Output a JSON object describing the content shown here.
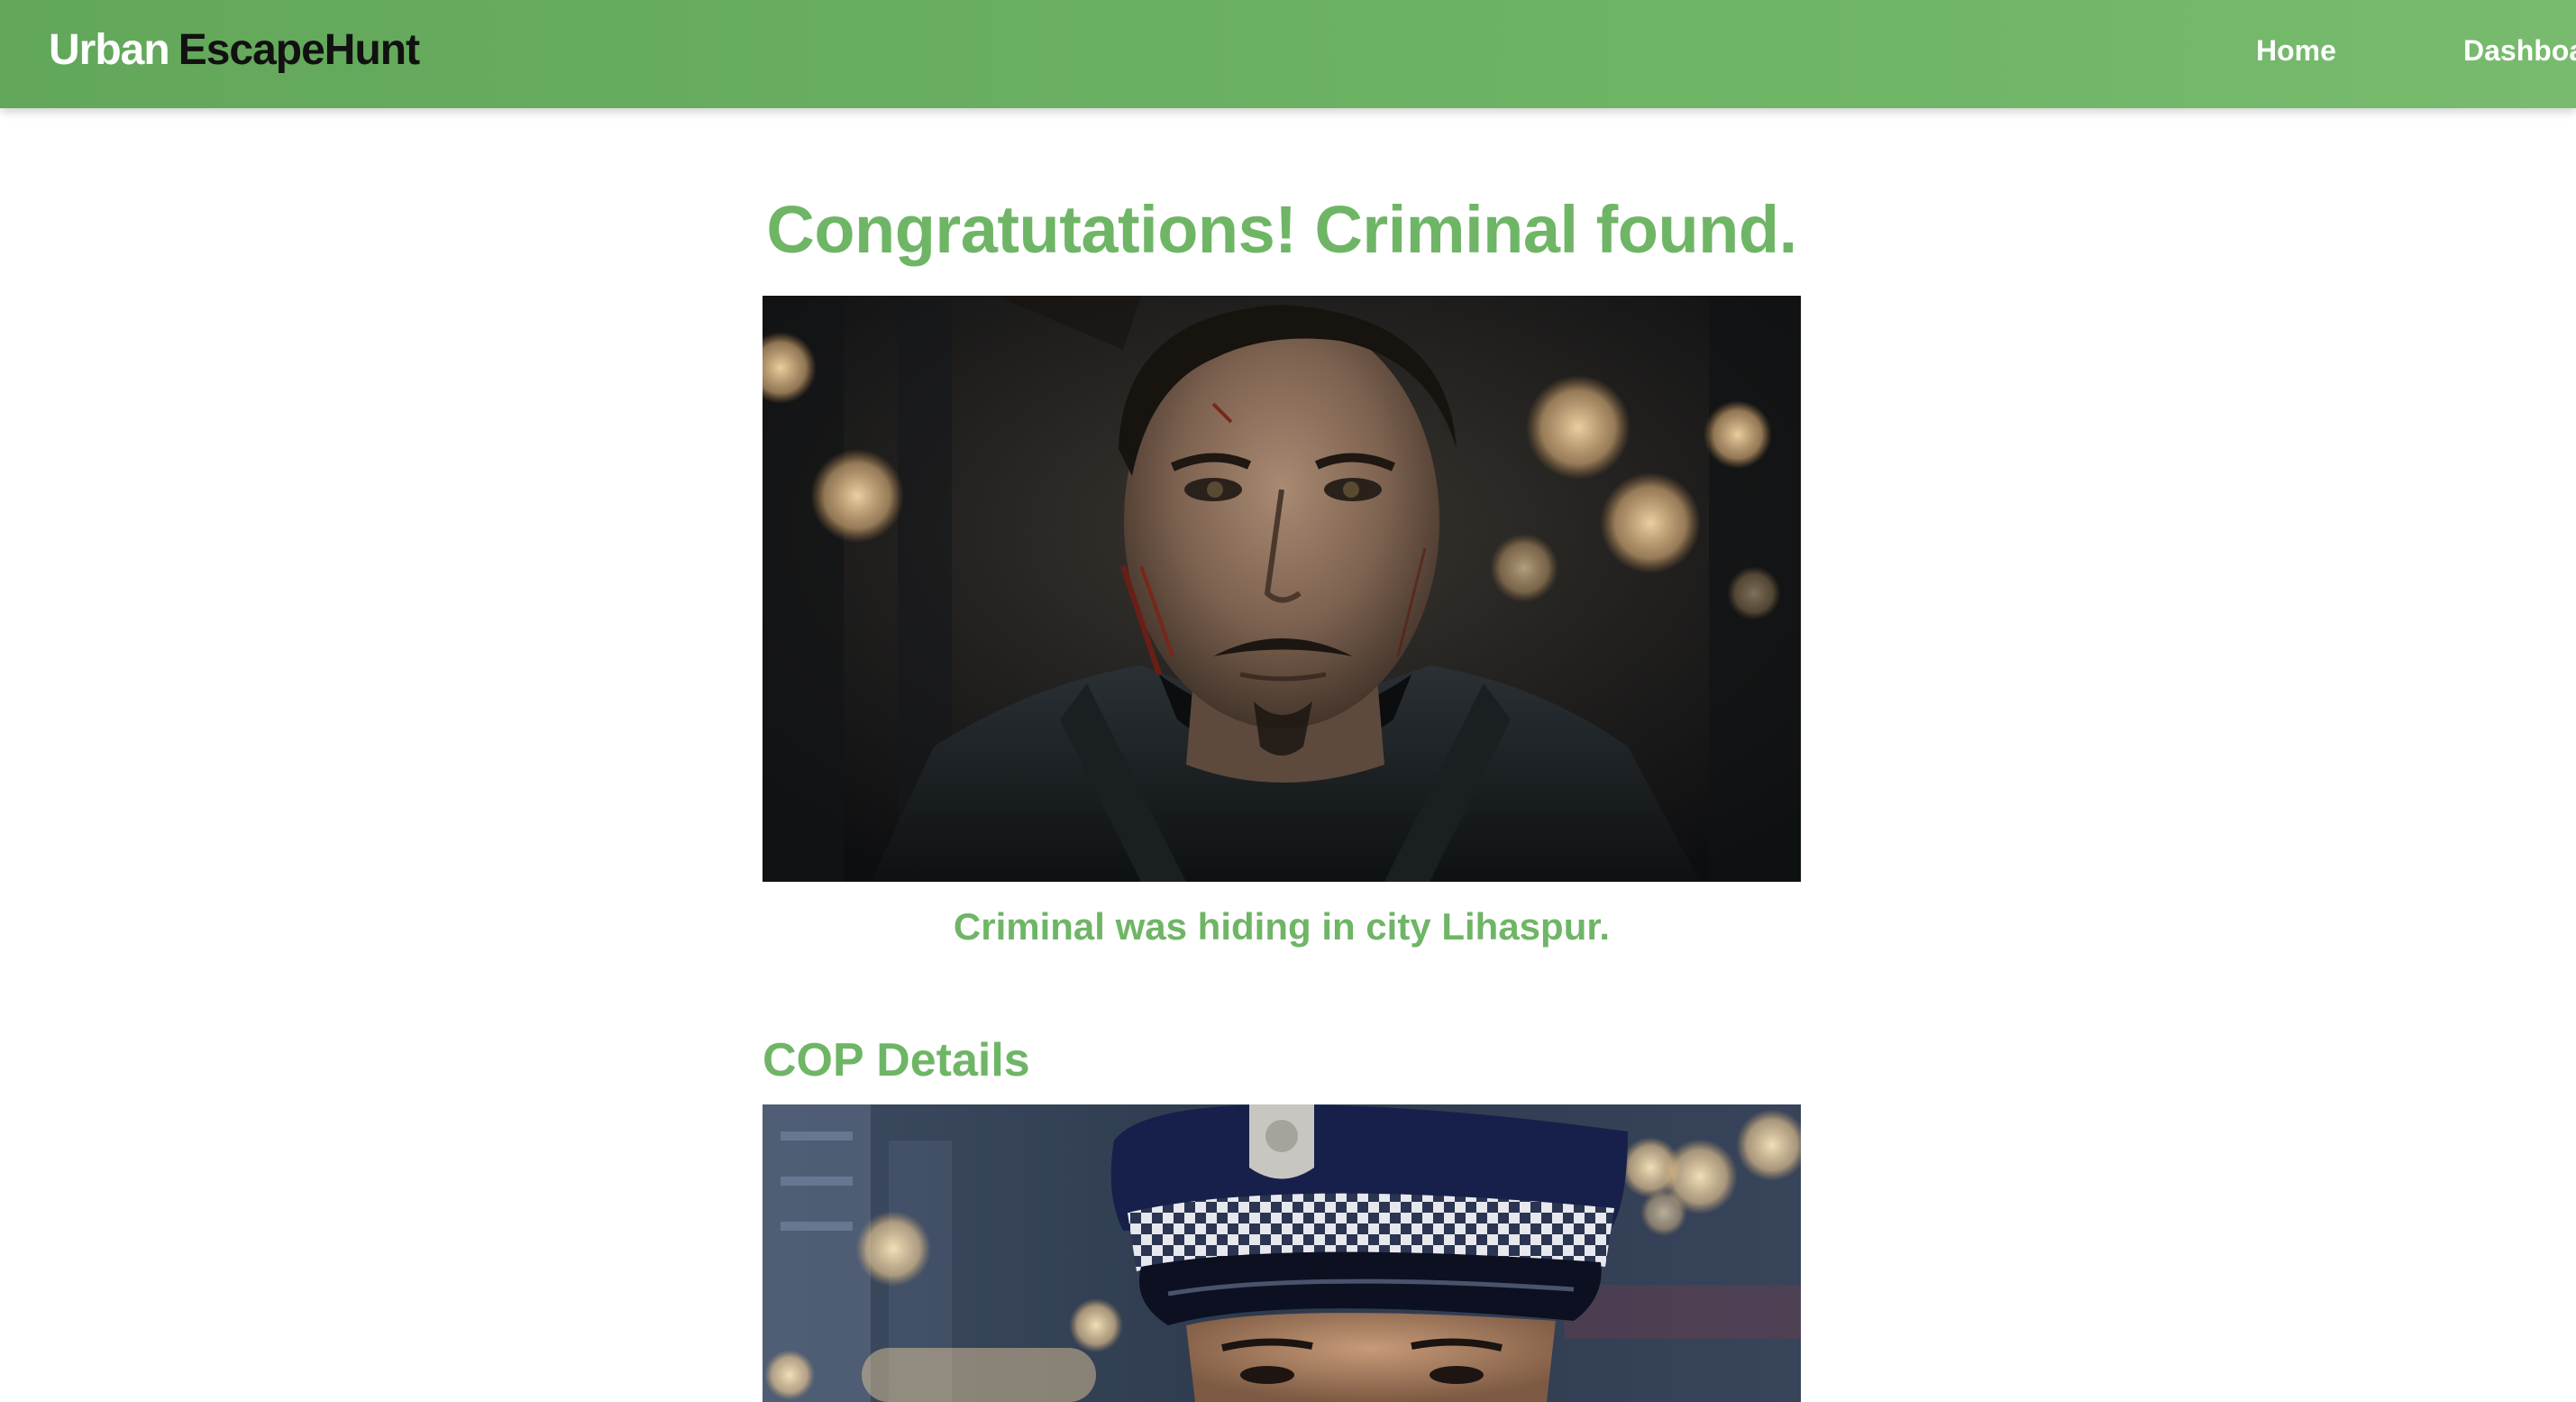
{
  "navbar": {
    "brand_part1": "Urban",
    "brand_part2": "EscapeHunt",
    "links": [
      {
        "label": "Home"
      },
      {
        "label": "Dashboard"
      }
    ],
    "bg_color": "#6fb566"
  },
  "result": {
    "title": "Congratutations! Criminal found.",
    "caption": "Criminal was hiding in city Lihaspur.",
    "accent_color": "#6fb566"
  },
  "criminal_image": {
    "subject": "criminal-portrait"
  },
  "cop_section": {
    "title": "COP Details",
    "image_subject": "police-officer-portrait"
  }
}
